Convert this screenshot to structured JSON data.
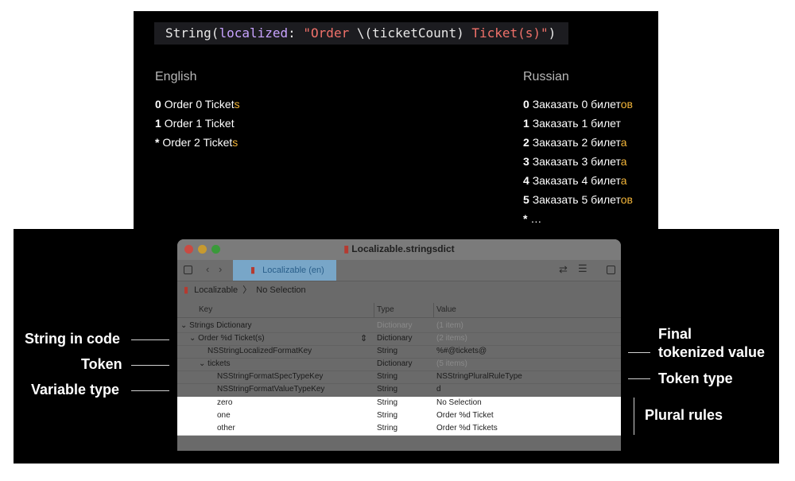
{
  "code": {
    "type_name": "String(",
    "param": "localized",
    "colon": ": ",
    "string_open": "\"Order ",
    "interp": "\\(ticketCount) ",
    "string_close": "Ticket(s)\"",
    "paren": ")"
  },
  "columns": {
    "english": {
      "title": "English",
      "rows": [
        {
          "key": "0",
          "text": "Order 0 Ticket",
          "suffix": "s"
        },
        {
          "key": "1",
          "text": "Order 1 Ticket",
          "suffix": ""
        },
        {
          "key": "*",
          "text": "Order 2 Ticket",
          "suffix": "s"
        }
      ]
    },
    "russian": {
      "title": "Russian",
      "rows": [
        {
          "key": "0",
          "text": "Заказать 0 билет",
          "suffix": "ов"
        },
        {
          "key": "1",
          "text": "Заказать 1 билет",
          "suffix": ""
        },
        {
          "key": "2",
          "text": "Заказать 2 билет",
          "suffix": "а"
        },
        {
          "key": "3",
          "text": "Заказать 3 билет",
          "suffix": "а"
        },
        {
          "key": "4",
          "text": "Заказать 4 билет",
          "suffix": "а"
        },
        {
          "key": "5",
          "text": "Заказать 5 билет",
          "suffix": "ов"
        },
        {
          "key": "*",
          "text": "…",
          "suffix": ""
        }
      ]
    }
  },
  "callouts": {
    "string_in_code": "String in code",
    "token": "Token",
    "variable_type": "Variable type",
    "final_line1": "Final",
    "final_line2": "tokenized value",
    "token_type": "Token type",
    "plural_rules": "Plural rules"
  },
  "window": {
    "title": "Localizable.stringsdict",
    "tab_label": "Localizable (en)",
    "breadcrumb_file": "Localizable",
    "breadcrumb_selection": "No Selection",
    "headers": {
      "key": "Key",
      "type": "Type",
      "value": "Value"
    },
    "rows": [
      {
        "key": "Strings Dictionary",
        "type": "Dictionary",
        "value": "(1 item)",
        "disclosure": "v",
        "dim": true
      },
      {
        "key": "Order %d Ticket(s)",
        "type": "Dictionary",
        "value": "(2 items)",
        "disclosure": "v",
        "dim": false
      },
      {
        "key": "NSStringLocalizedFormatKey",
        "type": "String",
        "value": "%#@tickets@",
        "disclosure": "",
        "dim": false
      },
      {
        "key": "tickets",
        "type": "Dictionary",
        "value": "(5 items)",
        "disclosure": "v",
        "dim": false
      },
      {
        "key": "NSStringFormatSpecTypeKey",
        "type": "String",
        "value": "NSStringPluralRuleType",
        "disclosure": "",
        "dim": false
      },
      {
        "key": "NSStringFormatValueTypeKey",
        "type": "String",
        "value": "d",
        "disclosure": "",
        "dim": false
      },
      {
        "key": "zero",
        "type": "String",
        "value": "No Selection",
        "disclosure": "",
        "dim": false
      },
      {
        "key": "one",
        "type": "String",
        "value": "Order %d Ticket",
        "disclosure": "",
        "dim": false
      },
      {
        "key": "other",
        "type": "String",
        "value": "Order %d Tickets",
        "disclosure": "",
        "dim": false
      }
    ]
  },
  "colors": {
    "suffix_highlight": "#f2b53a",
    "code_keyword": "#c8a3ff",
    "code_string": "#f0716a",
    "tab_blue": "#78a6c8"
  }
}
